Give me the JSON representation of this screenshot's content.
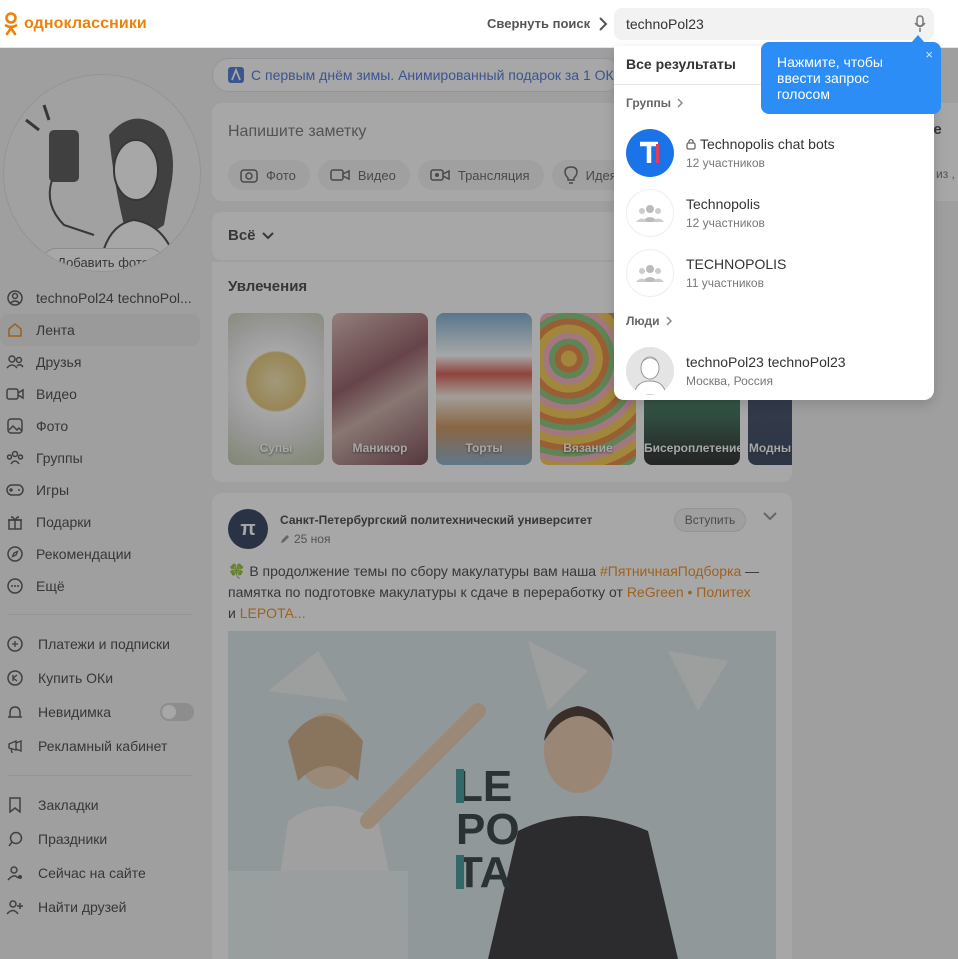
{
  "header": {
    "logo_text": "одноклассники",
    "collapse_label": "Свернуть поиск",
    "search_value": "technoPol23"
  },
  "sidebar": {
    "add_photo_label": "Добавить фото",
    "items": [
      {
        "label": "technoPol24 technoPol...",
        "icon": "profile-icon"
      },
      {
        "label": "Лента",
        "icon": "home-icon"
      },
      {
        "label": "Друзья",
        "icon": "friends-icon"
      },
      {
        "label": "Видео",
        "icon": "video-icon"
      },
      {
        "label": "Фото",
        "icon": "photo-icon"
      },
      {
        "label": "Группы",
        "icon": "groups-icon"
      },
      {
        "label": "Игры",
        "icon": "gamepad-icon"
      },
      {
        "label": "Подарки",
        "icon": "gift-icon"
      },
      {
        "label": "Рекомендации",
        "icon": "compass-icon"
      },
      {
        "label": "Ещё",
        "icon": "more-icon"
      }
    ],
    "items2": [
      {
        "label": "Платежи и подписки",
        "icon": "wallet-icon"
      },
      {
        "label": "Купить ОКи",
        "icon": "coin-icon"
      },
      {
        "label": "Невидимка",
        "icon": "invisible-icon"
      },
      {
        "label": "Рекламный кабинет",
        "icon": "megaphone-icon"
      }
    ],
    "items3": [
      {
        "label": "Закладки",
        "icon": "bookmark-icon"
      },
      {
        "label": "Праздники",
        "icon": "balloon-icon"
      },
      {
        "label": "Сейчас на сайте",
        "icon": "online-icon"
      },
      {
        "label": "Найти друзей",
        "icon": "add-friend-icon"
      }
    ]
  },
  "banner": {
    "text": "С первым днём зимы. Анимированный подарок за 1 ОК"
  },
  "note": {
    "placeholder": "Напишите заметку",
    "buttons": [
      "Фото",
      "Видео",
      "Трансляция",
      "Идея"
    ]
  },
  "filter": {
    "label": "Всё"
  },
  "hobbies": {
    "title": "Увлечения",
    "tiles": [
      "Супы",
      "Маникюр",
      "Торты",
      "Вязание",
      "Бисероплетение",
      "Модны"
    ]
  },
  "post": {
    "logo_letter": "π",
    "author": "Санкт-Петербургский политехнический университет",
    "date": "25 ноя",
    "join_label": "Вступить",
    "text_before": "🍀 В продолжение темы по сбору макулатуры вам наша ",
    "hashtag": "#ПятничнаяПодборка",
    "text_mid": " — памятка по подготовке макулатуры к сдаче в переработку от ",
    "link1": "ReGreen • Политех",
    "text_and": " и ",
    "link2": "LEPOTA",
    "ellipsis": "...",
    "image_logo_lines": [
      "LE",
      "PO",
      "TA"
    ]
  },
  "right_teaser": {
    "title": "те",
    "text": "о из ,"
  },
  "dropdown": {
    "tab_label": "Все результаты",
    "groups_label": "Группы",
    "groups": [
      {
        "name": "Technopolis chat bots",
        "sub": "12 участников",
        "locked": true
      },
      {
        "name": "Technopolis",
        "sub": "12 участников",
        "locked": false
      },
      {
        "name": "TECHNOPOLIS",
        "sub": "11 участников",
        "locked": false
      }
    ],
    "people_label": "Люди",
    "people": [
      {
        "name": "technoPol23 technoPol23",
        "sub": "Москва, Россия"
      }
    ]
  },
  "tooltip": {
    "text": "Нажмите, чтобы ввести запрос голосом",
    "close": "×"
  },
  "colors": {
    "brand": "#ee8208",
    "accent": "#2b8df5",
    "link": "#3a6ad6"
  }
}
